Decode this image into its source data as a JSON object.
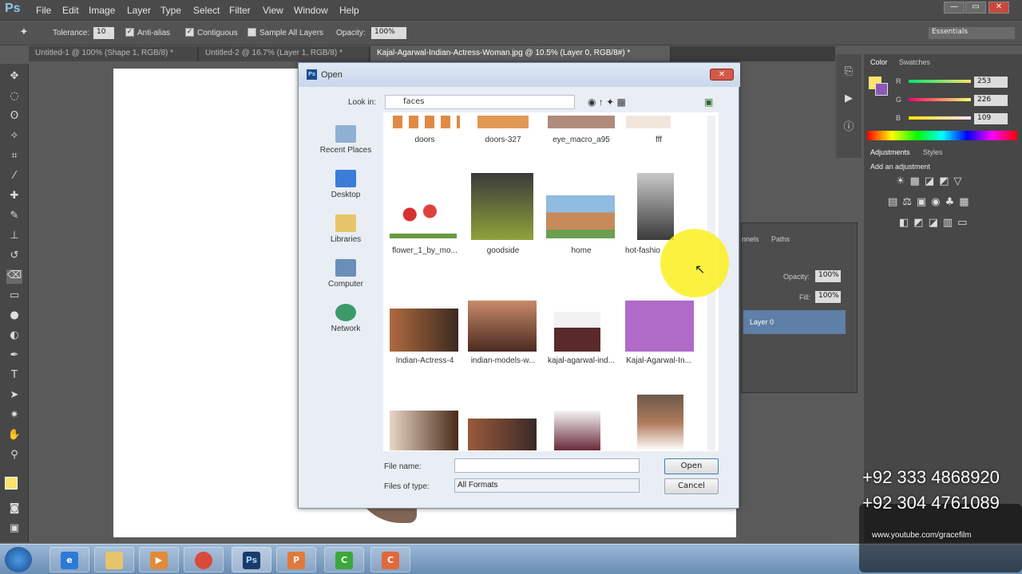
{
  "menubar": {
    "logo": "Ps",
    "items": [
      "File",
      "Edit",
      "Image",
      "Layer",
      "Type",
      "Select",
      "Filter",
      "View",
      "Window",
      "Help"
    ],
    "window_controls": [
      "—",
      "▭",
      "✕"
    ]
  },
  "options": {
    "tolerance_label": "Tolerance:",
    "tolerance": "10",
    "antialias": "Anti-alias",
    "contiguous": "Contiguous",
    "sample_all": "Sample All Layers",
    "opacity_label": "Opacity:",
    "opacity": "100%",
    "workspace": "Essentials"
  },
  "tabs": [
    "Untitled-1 @ 100% (Shape 1, RGB/8) *",
    "Untitled-2 @ 16.7% (Layer 1, RGB/8) *",
    "Kajal-Agarwal-Indian-Actress-Woman.jpg @ 10.5% (Layer 0, RGB/8#) *"
  ],
  "color_panel": {
    "tab_color": "Color",
    "tab_swatches": "Swatches",
    "r_label": "R",
    "g_label": "G",
    "b_label": "B",
    "r": "253",
    "g": "226",
    "b": "109",
    "foreground": "#fde26d",
    "background": "#8e58b8"
  },
  "adjust_panel": {
    "tab_adjust": "Adjustments",
    "tab_styles": "Styles",
    "hint": "Add an adjustment"
  },
  "layers_panel": {
    "tab_channels": "nnels",
    "tab_paths": "Paths",
    "opacity_label": "Opacity:",
    "opacity": "100%",
    "fill_label": "Fill:",
    "fill": "100%",
    "layer_name": "Layer 0"
  },
  "dialog": {
    "title": "Open",
    "close": "✕",
    "look_in_label": "Look in:",
    "look_in": "faces",
    "places": [
      "Recent Places",
      "Desktop",
      "Libraries",
      "Computer",
      "Network"
    ],
    "row1": [
      "doors",
      "doors-327",
      "eye_macro_a95",
      "fff"
    ],
    "row2": [
      "flower_1_by_mo...",
      "goodside",
      "home",
      "hot-fashio"
    ],
    "row3": [
      "Indian-Actress-4",
      "indian-models-w...",
      "kajal-agarwal-ind...",
      "Kajal-Agarwal-In..."
    ],
    "file_name_label": "File name:",
    "file_name": "",
    "files_of_type_label": "Files of type:",
    "files_of_type": "All Formats",
    "open_btn": "Open",
    "cancel_btn": "Cancel"
  },
  "overlay": {
    "phone1": "+92 333 4868920",
    "phone2": "+92 304 4761089",
    "url": "www.youtube.com/gracefilm"
  }
}
